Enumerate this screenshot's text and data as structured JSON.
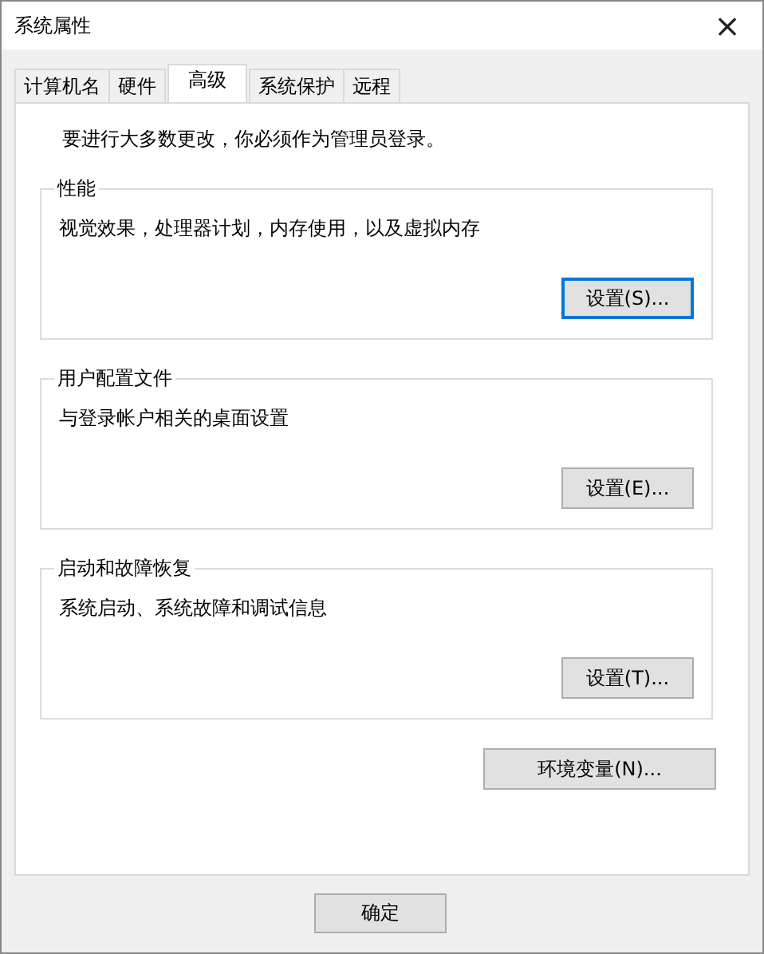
{
  "window": {
    "title": "系统属性",
    "close": "×"
  },
  "tabs": [
    {
      "label": "计算机名",
      "selected": false
    },
    {
      "label": "硬件",
      "selected": false
    },
    {
      "label": "高级",
      "selected": true
    },
    {
      "label": "系统保护",
      "selected": false
    },
    {
      "label": "远程",
      "selected": false
    }
  ],
  "notice": "要进行大多数更改，你必须作为管理员登录。",
  "groups": [
    {
      "title": "性能",
      "description": "视觉效果，处理器计划，内存使用，以及虚拟内存",
      "button": {
        "label": "设置(S)...",
        "default": true
      }
    },
    {
      "title": "用户配置文件",
      "description": "与登录帐户相关的桌面设置",
      "button": {
        "label": "设置(E)...",
        "default": false
      }
    },
    {
      "title": "启动和故障恢复",
      "description": "系统启动、系统故障和调试信息",
      "button": {
        "label": "设置(T)...",
        "default": false
      }
    }
  ],
  "env_button": "环境变量(N)...",
  "footer_buttons": [
    "确定"
  ]
}
